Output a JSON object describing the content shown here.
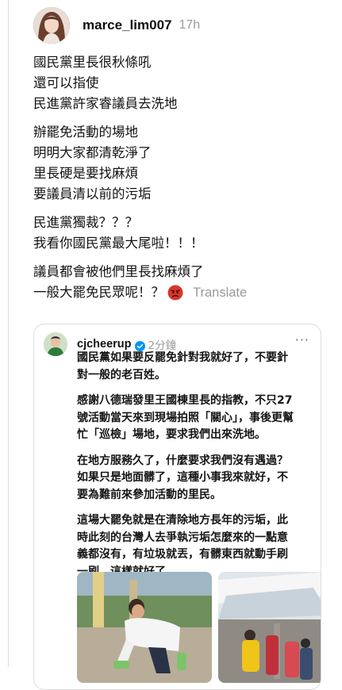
{
  "post": {
    "username": "marce_lim007",
    "timestamp": "17h",
    "paragraphs": [
      [
        "國民黨里長很秋條吼",
        "還可以指使",
        "民進黨許家睿議員去洗地"
      ],
      [
        "辦罷免活動的場地",
        "明明大家都清乾淨了",
        "里長硬是要找麻煩",
        "要議員清以前的污垢"
      ],
      [
        "民進黨獨裁？？？",
        "我看你國民黨最大尾啦！！！"
      ],
      [
        "議員都會被他們里長找麻煩了"
      ]
    ],
    "last_line": "一般大罷免民眾呢！？",
    "translate_label": "Translate",
    "emoji": "angry-face"
  },
  "quoted": {
    "username": "cjcheerup",
    "timestamp": "2分鐘",
    "verified": true,
    "more_label": "···",
    "paragraphs": [
      [
        "國民黨如果要反罷免針對我就好了，不要針",
        "對一般的老百姓。"
      ],
      [
        "感謝八德瑞發里王國棟里長的指教，不只27",
        "號活動當天來到現場拍照「關心」，事後更幫",
        "忙「巡檢」場地，要求我們出來洗地。"
      ],
      [
        "在地方服務久了，什麼要求我們沒有遇過？",
        "如果只是地面髒了，這種小事我來就好，不",
        "要為難前來參加活動的里民。"
      ],
      [
        "這場大罷免就是在清除地方長年的污垢，此",
        "時此刻的台灣人去爭執污垢怎麼來的一點意",
        "義都沒有，有垃圾就丟，有髒東西就動手刷",
        "一刷，這樣就好了。"
      ]
    ],
    "media": [
      "photo-man-scrubbing-ground",
      "photo-event-canopy-crowd"
    ]
  },
  "colors": {
    "verified_blue": "#0095f6",
    "secondary_text": "#9a9a9a",
    "angry_red": "#d9362b"
  }
}
